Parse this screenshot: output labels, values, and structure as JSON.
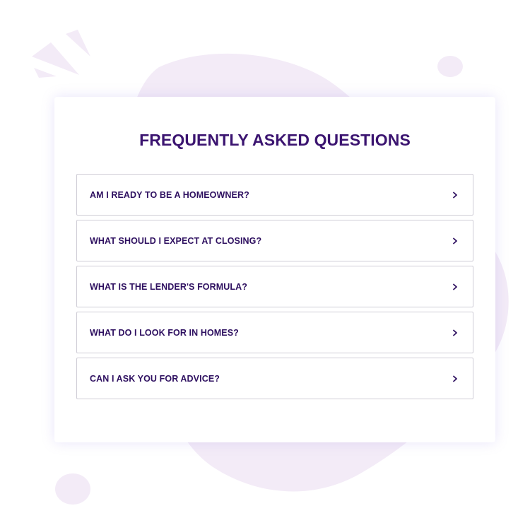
{
  "faq": {
    "title": "FREQUENTLY ASKED QUESTIONS",
    "items": [
      {
        "question": "AM I READY TO BE A HOMEOWNER?"
      },
      {
        "question": "WHAT SHOULD I EXPECT AT CLOSING?"
      },
      {
        "question": "WHAT IS THE LENDER'S FORMULA?"
      },
      {
        "question": "WHAT DO I LOOK FOR IN HOMES?"
      },
      {
        "question": "CAN I ASK YOU FOR ADVICE?"
      }
    ]
  },
  "theme": {
    "accent": "#3b1470",
    "background_blob": "#f3ebf7",
    "border": "#cfcdd6",
    "text": "#2e1060"
  },
  "icons": {
    "expand": "chevron-right-icon"
  }
}
